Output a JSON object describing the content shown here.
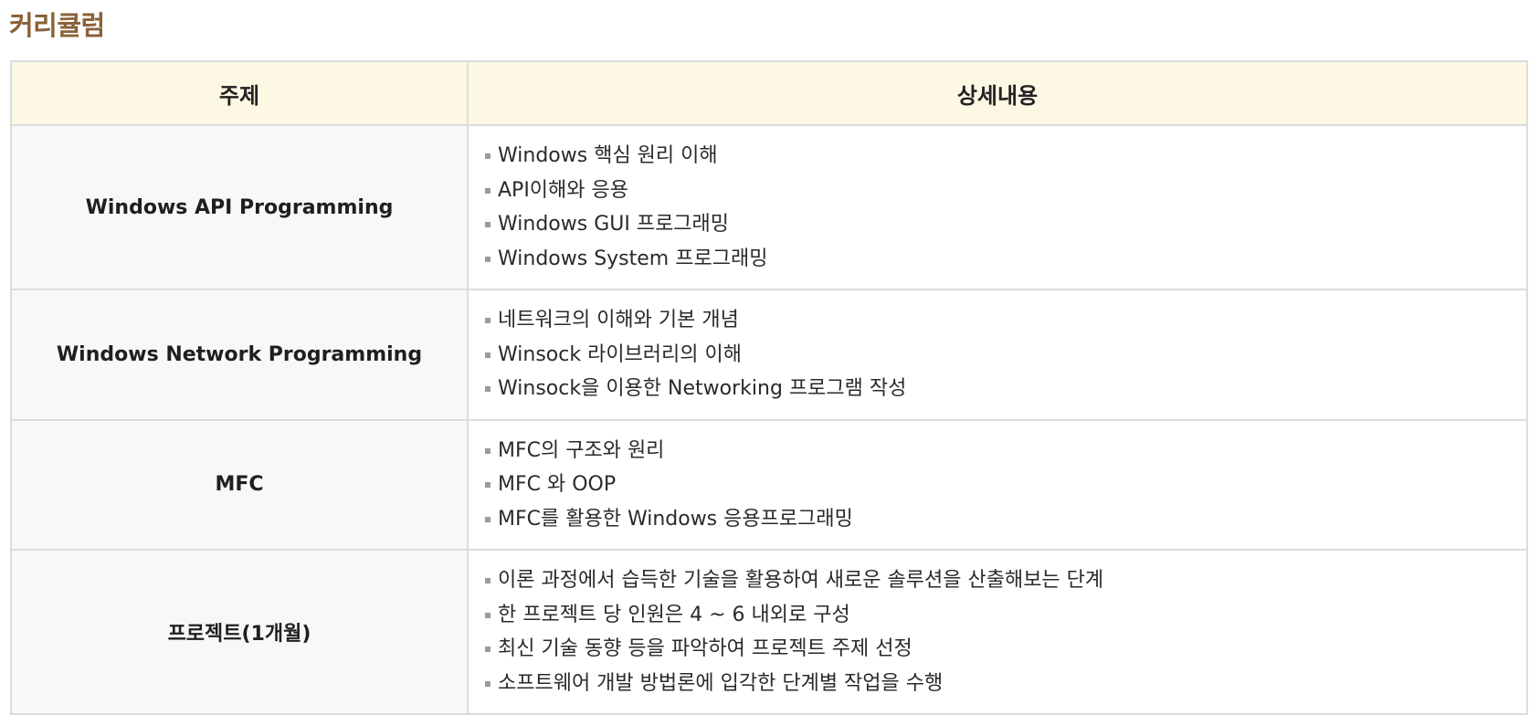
{
  "page": {
    "title": "커리큘럼"
  },
  "table": {
    "headers": {
      "subject": "주제",
      "details": "상세내용"
    },
    "rows": [
      {
        "subject": "Windows API Programming",
        "details": [
          "Windows 핵심 원리 이해",
          "API이해와 응용",
          "Windows GUI 프로그래밍",
          "Windows System 프로그래밍"
        ]
      },
      {
        "subject": "Windows Network Programming",
        "details": [
          "네트워크의 이해와 기본 개념",
          "Winsock 라이브러리의 이해",
          "Winsock을 이용한 Networking 프로그램 작성"
        ]
      },
      {
        "subject": "MFC",
        "details": [
          "MFC의 구조와 원리",
          "MFC 와 OOP",
          "MFC를 활용한 Windows 응용프로그래밍"
        ]
      },
      {
        "subject": "프로젝트(1개월)",
        "details": [
          "이론 과정에서 습득한 기술을 활용하여 새로운 솔루션을 산출해보는 단계",
          "한 프로젝트 당 인원은 4 ~ 6 내외로 구성",
          "최신 기술 동향 등을 파악하여 프로젝트 주제 선정",
          "소프트웨어 개발 방법론에 입각한 단계별 작업을 수행"
        ]
      }
    ]
  }
}
